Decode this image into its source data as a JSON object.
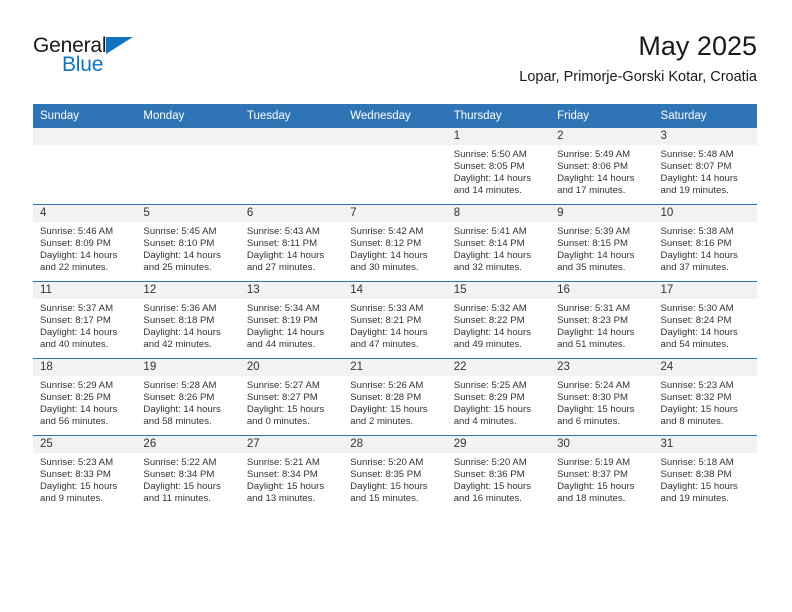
{
  "brand": {
    "name_part1": "General",
    "name_part2": "Blue",
    "triangle_color": "#1274c0"
  },
  "header": {
    "title": "May 2025",
    "subtitle": "Lopar, Primorje-Gorski Kotar, Croatia",
    "accent_color": "#2f74b5",
    "band_color": "#f2f2f2"
  },
  "weekday_headers": [
    "Sunday",
    "Monday",
    "Tuesday",
    "Wednesday",
    "Thursday",
    "Friday",
    "Saturday"
  ],
  "labels": {
    "sunrise_prefix": "Sunrise:",
    "sunset_prefix": "Sunset:",
    "daylight_prefix": "Daylight:"
  },
  "weeks": [
    [
      {
        "day": "",
        "empty": true
      },
      {
        "day": "",
        "empty": true
      },
      {
        "day": "",
        "empty": true
      },
      {
        "day": "",
        "empty": true
      },
      {
        "day": "1",
        "sunrise": "Sunrise: 5:50 AM",
        "sunset": "Sunset: 8:05 PM",
        "daylight_line1": "Daylight: 14 hours",
        "daylight_line2": "and 14 minutes."
      },
      {
        "day": "2",
        "sunrise": "Sunrise: 5:49 AM",
        "sunset": "Sunset: 8:06 PM",
        "daylight_line1": "Daylight: 14 hours",
        "daylight_line2": "and 17 minutes."
      },
      {
        "day": "3",
        "sunrise": "Sunrise: 5:48 AM",
        "sunset": "Sunset: 8:07 PM",
        "daylight_line1": "Daylight: 14 hours",
        "daylight_line2": "and 19 minutes."
      }
    ],
    [
      {
        "day": "4",
        "sunrise": "Sunrise: 5:46 AM",
        "sunset": "Sunset: 8:09 PM",
        "daylight_line1": "Daylight: 14 hours",
        "daylight_line2": "and 22 minutes."
      },
      {
        "day": "5",
        "sunrise": "Sunrise: 5:45 AM",
        "sunset": "Sunset: 8:10 PM",
        "daylight_line1": "Daylight: 14 hours",
        "daylight_line2": "and 25 minutes."
      },
      {
        "day": "6",
        "sunrise": "Sunrise: 5:43 AM",
        "sunset": "Sunset: 8:11 PM",
        "daylight_line1": "Daylight: 14 hours",
        "daylight_line2": "and 27 minutes."
      },
      {
        "day": "7",
        "sunrise": "Sunrise: 5:42 AM",
        "sunset": "Sunset: 8:12 PM",
        "daylight_line1": "Daylight: 14 hours",
        "daylight_line2": "and 30 minutes."
      },
      {
        "day": "8",
        "sunrise": "Sunrise: 5:41 AM",
        "sunset": "Sunset: 8:14 PM",
        "daylight_line1": "Daylight: 14 hours",
        "daylight_line2": "and 32 minutes."
      },
      {
        "day": "9",
        "sunrise": "Sunrise: 5:39 AM",
        "sunset": "Sunset: 8:15 PM",
        "daylight_line1": "Daylight: 14 hours",
        "daylight_line2": "and 35 minutes."
      },
      {
        "day": "10",
        "sunrise": "Sunrise: 5:38 AM",
        "sunset": "Sunset: 8:16 PM",
        "daylight_line1": "Daylight: 14 hours",
        "daylight_line2": "and 37 minutes."
      }
    ],
    [
      {
        "day": "11",
        "sunrise": "Sunrise: 5:37 AM",
        "sunset": "Sunset: 8:17 PM",
        "daylight_line1": "Daylight: 14 hours",
        "daylight_line2": "and 40 minutes."
      },
      {
        "day": "12",
        "sunrise": "Sunrise: 5:36 AM",
        "sunset": "Sunset: 8:18 PM",
        "daylight_line1": "Daylight: 14 hours",
        "daylight_line2": "and 42 minutes."
      },
      {
        "day": "13",
        "sunrise": "Sunrise: 5:34 AM",
        "sunset": "Sunset: 8:19 PM",
        "daylight_line1": "Daylight: 14 hours",
        "daylight_line2": "and 44 minutes."
      },
      {
        "day": "14",
        "sunrise": "Sunrise: 5:33 AM",
        "sunset": "Sunset: 8:21 PM",
        "daylight_line1": "Daylight: 14 hours",
        "daylight_line2": "and 47 minutes."
      },
      {
        "day": "15",
        "sunrise": "Sunrise: 5:32 AM",
        "sunset": "Sunset: 8:22 PM",
        "daylight_line1": "Daylight: 14 hours",
        "daylight_line2": "and 49 minutes."
      },
      {
        "day": "16",
        "sunrise": "Sunrise: 5:31 AM",
        "sunset": "Sunset: 8:23 PM",
        "daylight_line1": "Daylight: 14 hours",
        "daylight_line2": "and 51 minutes."
      },
      {
        "day": "17",
        "sunrise": "Sunrise: 5:30 AM",
        "sunset": "Sunset: 8:24 PM",
        "daylight_line1": "Daylight: 14 hours",
        "daylight_line2": "and 54 minutes."
      }
    ],
    [
      {
        "day": "18",
        "sunrise": "Sunrise: 5:29 AM",
        "sunset": "Sunset: 8:25 PM",
        "daylight_line1": "Daylight: 14 hours",
        "daylight_line2": "and 56 minutes."
      },
      {
        "day": "19",
        "sunrise": "Sunrise: 5:28 AM",
        "sunset": "Sunset: 8:26 PM",
        "daylight_line1": "Daylight: 14 hours",
        "daylight_line2": "and 58 minutes."
      },
      {
        "day": "20",
        "sunrise": "Sunrise: 5:27 AM",
        "sunset": "Sunset: 8:27 PM",
        "daylight_line1": "Daylight: 15 hours",
        "daylight_line2": "and 0 minutes."
      },
      {
        "day": "21",
        "sunrise": "Sunrise: 5:26 AM",
        "sunset": "Sunset: 8:28 PM",
        "daylight_line1": "Daylight: 15 hours",
        "daylight_line2": "and 2 minutes."
      },
      {
        "day": "22",
        "sunrise": "Sunrise: 5:25 AM",
        "sunset": "Sunset: 8:29 PM",
        "daylight_line1": "Daylight: 15 hours",
        "daylight_line2": "and 4 minutes."
      },
      {
        "day": "23",
        "sunrise": "Sunrise: 5:24 AM",
        "sunset": "Sunset: 8:30 PM",
        "daylight_line1": "Daylight: 15 hours",
        "daylight_line2": "and 6 minutes."
      },
      {
        "day": "24",
        "sunrise": "Sunrise: 5:23 AM",
        "sunset": "Sunset: 8:32 PM",
        "daylight_line1": "Daylight: 15 hours",
        "daylight_line2": "and 8 minutes."
      }
    ],
    [
      {
        "day": "25",
        "sunrise": "Sunrise: 5:23 AM",
        "sunset": "Sunset: 8:33 PM",
        "daylight_line1": "Daylight: 15 hours",
        "daylight_line2": "and 9 minutes."
      },
      {
        "day": "26",
        "sunrise": "Sunrise: 5:22 AM",
        "sunset": "Sunset: 8:34 PM",
        "daylight_line1": "Daylight: 15 hours",
        "daylight_line2": "and 11 minutes."
      },
      {
        "day": "27",
        "sunrise": "Sunrise: 5:21 AM",
        "sunset": "Sunset: 8:34 PM",
        "daylight_line1": "Daylight: 15 hours",
        "daylight_line2": "and 13 minutes."
      },
      {
        "day": "28",
        "sunrise": "Sunrise: 5:20 AM",
        "sunset": "Sunset: 8:35 PM",
        "daylight_line1": "Daylight: 15 hours",
        "daylight_line2": "and 15 minutes."
      },
      {
        "day": "29",
        "sunrise": "Sunrise: 5:20 AM",
        "sunset": "Sunset: 8:36 PM",
        "daylight_line1": "Daylight: 15 hours",
        "daylight_line2": "and 16 minutes."
      },
      {
        "day": "30",
        "sunrise": "Sunrise: 5:19 AM",
        "sunset": "Sunset: 8:37 PM",
        "daylight_line1": "Daylight: 15 hours",
        "daylight_line2": "and 18 minutes."
      },
      {
        "day": "31",
        "sunrise": "Sunrise: 5:18 AM",
        "sunset": "Sunset: 8:38 PM",
        "daylight_line1": "Daylight: 15 hours",
        "daylight_line2": "and 19 minutes."
      }
    ]
  ]
}
